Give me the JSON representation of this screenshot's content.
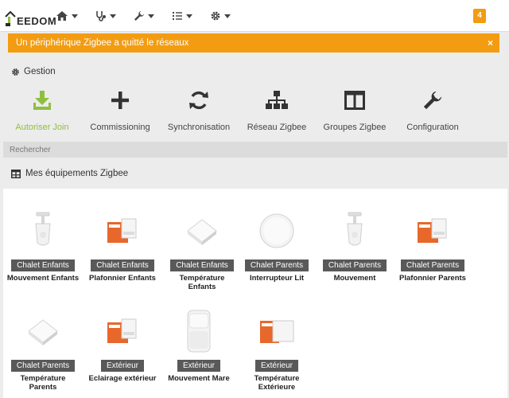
{
  "logo": {
    "text": "EEDOM"
  },
  "notifications": {
    "count": "4"
  },
  "alert": {
    "message": "Un périphérique Zigbee a quitté le réseaux",
    "close": "×"
  },
  "gestion": {
    "title": "Gestion",
    "actions": [
      {
        "label": "Autoriser Join",
        "icon": "download-icon",
        "active": true
      },
      {
        "label": "Commissioning",
        "icon": "plus-icon"
      },
      {
        "label": "Synchronisation",
        "icon": "refresh-icon"
      },
      {
        "label": "Réseau Zigbee",
        "icon": "sitemap-icon"
      },
      {
        "label": "Groupes Zigbee",
        "icon": "columns-icon"
      },
      {
        "label": "Configuration",
        "icon": "wrench-icon"
      }
    ]
  },
  "search": {
    "placeholder": "Rechercher"
  },
  "equipment": {
    "title": "Mes équipements Zigbee",
    "items": [
      {
        "room": "Chalet Enfants",
        "name": "Mouvement Enfants",
        "device": "motion-sensor"
      },
      {
        "room": "Chalet Enfants",
        "name": "Plafonnier Enfants",
        "device": "relay-module"
      },
      {
        "room": "Chalet Enfants",
        "name": "Température Enfants",
        "device": "temperature-sensor"
      },
      {
        "room": "Chalet Parents",
        "name": "Interrupteur Lit",
        "device": "round-switch"
      },
      {
        "room": "Chalet Parents",
        "name": "Mouvement",
        "device": "motion-sensor"
      },
      {
        "room": "Chalet Parents",
        "name": "Plafonnier Parents",
        "device": "relay-module"
      },
      {
        "room": "Chalet Parents",
        "name": "Température Parents",
        "device": "temperature-sensor"
      },
      {
        "room": "Extérieur",
        "name": "Eclairage extérieur",
        "device": "relay-module"
      },
      {
        "room": "Extérieur",
        "name": "Mouvement Mare",
        "device": "motion-sensor-large"
      },
      {
        "room": "Extérieur",
        "name": "Température Extérieure",
        "device": "relay-module-small"
      }
    ]
  },
  "colors": {
    "accent": "#f39c12",
    "active": "#8fbf3f",
    "badge": "#595959"
  }
}
